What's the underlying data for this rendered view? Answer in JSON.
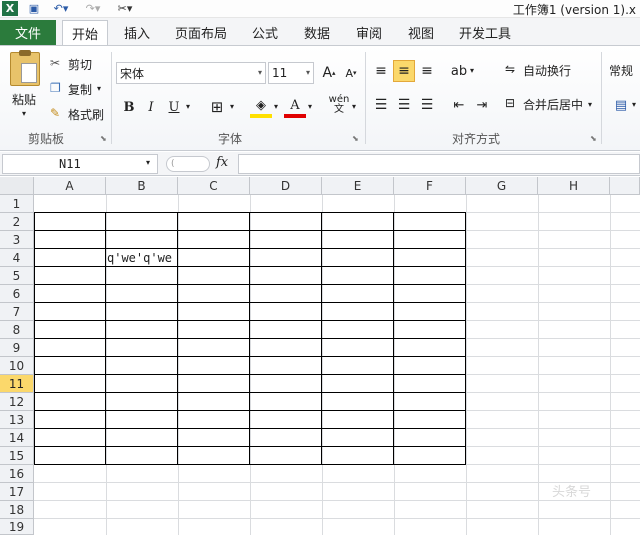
{
  "window": {
    "title": "工作簿1 (version 1).x"
  },
  "tabs": {
    "file": "文件",
    "items": [
      "开始",
      "插入",
      "页面布局",
      "公式",
      "数据",
      "审阅",
      "视图",
      "开发工具"
    ],
    "active": "开始"
  },
  "ribbon": {
    "clipboard": {
      "paste": "粘贴",
      "cut": "剪切",
      "copy": "复制",
      "format_painter": "格式刷",
      "label": "剪贴板"
    },
    "font": {
      "name": "宋体",
      "size": "11",
      "bold": "B",
      "italic": "I",
      "underline": "U",
      "label": "字体"
    },
    "alignment": {
      "wrap_text": "自动换行",
      "merge_center": "合并后居中",
      "label": "对齐方式"
    },
    "number": {
      "format": "常规"
    }
  },
  "formula_bar": {
    "name_box": "N11",
    "fx": "fx",
    "content": ""
  },
  "sheet": {
    "columns": [
      "A",
      "B",
      "C",
      "D",
      "E",
      "F",
      "G",
      "H"
    ],
    "rows": [
      "1",
      "2",
      "3",
      "4",
      "5",
      "6",
      "7",
      "8",
      "9",
      "10",
      "11",
      "12",
      "13",
      "14",
      "15",
      "16",
      "17",
      "18",
      "19"
    ],
    "active_row": "11",
    "cells": {
      "B4": "q'we'q'we"
    }
  },
  "watermark": "头条号"
}
